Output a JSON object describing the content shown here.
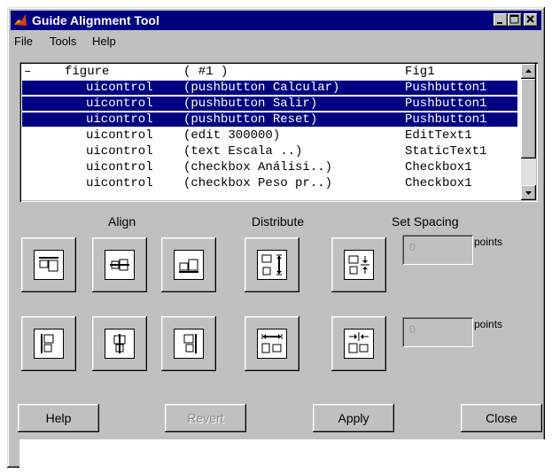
{
  "window": {
    "title": "Guide Alignment Tool",
    "minimize_icon": "minimize-icon",
    "maximize_icon": "maximize-icon",
    "close_icon": "close-icon"
  },
  "menu": [
    "File",
    "Tools",
    "Help"
  ],
  "list": {
    "rows": [
      {
        "toggle": "–",
        "type": "figure",
        "desc": "( #1 )",
        "tag": "Fig1",
        "selected": false
      },
      {
        "toggle": "",
        "type": "uicontrol",
        "desc": "(pushbutton Calcular)",
        "tag": "Pushbutton1",
        "selected": true
      },
      {
        "toggle": "",
        "type": "uicontrol",
        "desc": "(pushbutton Salir)",
        "tag": "Pushbutton1",
        "selected": true
      },
      {
        "toggle": "",
        "type": "uicontrol",
        "desc": "(pushbutton Reset)",
        "tag": "Pushbutton1",
        "selected": true
      },
      {
        "toggle": "",
        "type": "uicontrol",
        "desc": "(edit 300000)",
        "tag": "EditText1",
        "selected": false
      },
      {
        "toggle": "",
        "type": "uicontrol",
        "desc": "(text Escala ..)",
        "tag": "StaticText1",
        "selected": false
      },
      {
        "toggle": "",
        "type": "uicontrol",
        "desc": "(checkbox Análisi..)",
        "tag": "Checkbox1",
        "selected": false
      },
      {
        "toggle": "",
        "type": "uicontrol",
        "desc": "(checkbox Peso pr..)",
        "tag": "Checkbox1",
        "selected": false
      }
    ]
  },
  "sections": {
    "align": "Align",
    "distribute": "Distribute",
    "set_spacing": "Set Spacing"
  },
  "spacing": {
    "vertical_value": "0",
    "horizontal_value": "0",
    "units": "points"
  },
  "buttons": {
    "help": "Help",
    "revert": "Revert",
    "apply": "Apply",
    "close": "Close"
  },
  "colors": {
    "titlebar": "#000080",
    "selection": "#000080",
    "face": "#c0c0c0"
  }
}
